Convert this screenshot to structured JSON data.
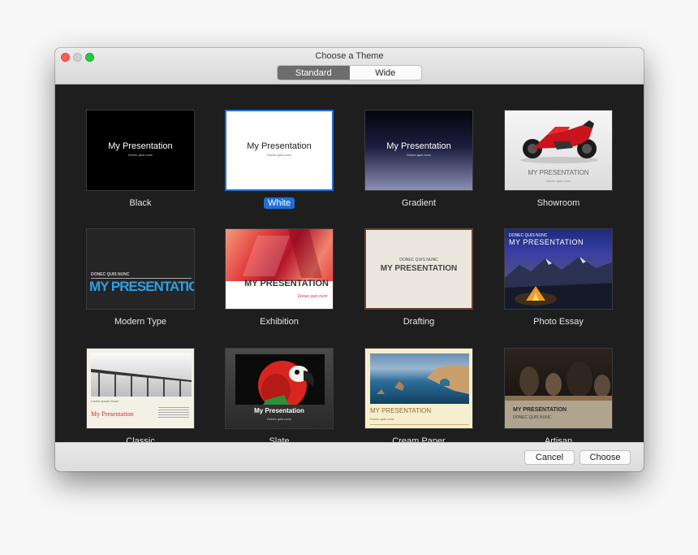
{
  "window": {
    "title": "Choose a Theme"
  },
  "segmented": {
    "standard": "Standard",
    "wide": "Wide"
  },
  "themes": [
    {
      "name": "Black",
      "title": "My Presentation",
      "subtitle": "Donec quis nunc"
    },
    {
      "name": "White",
      "title": "My Presentation",
      "subtitle": "Donec quis nunc"
    },
    {
      "name": "Gradient",
      "title": "My Presentation",
      "subtitle": "Donec quis nunc"
    },
    {
      "name": "Showroom",
      "title": "MY PRESENTATION",
      "subtitle": "Donec quis nunc"
    },
    {
      "name": "Modern Type",
      "title": "MY PRESENTATION",
      "subtitle": "DONEC QUIS NUNC"
    },
    {
      "name": "Exhibition",
      "title": "MY PRESENTATION",
      "subtitle": "Donec quis nunc"
    },
    {
      "name": "Drafting",
      "title": "MY PRESENTATION",
      "subtitle": "DONEC QUIS NUNC"
    },
    {
      "name": "Photo Essay",
      "title": "MY PRESENTATION",
      "subtitle": "DONEC QUIS NUNC"
    },
    {
      "name": "Classic",
      "title": "My Presentation",
      "subtitle": "Lorem Ipsum Dolor"
    },
    {
      "name": "Slate",
      "title": "My Presentation",
      "subtitle": "Donec quis nunc"
    },
    {
      "name": "Cream Paper",
      "title": "MY PRESENTATION",
      "subtitle": "Donec quis nunc"
    },
    {
      "name": "Artisan",
      "title": "MY PRESENTATION",
      "subtitle": "DONEC QUIS NUNC"
    }
  ],
  "buttons": {
    "cancel": "Cancel",
    "choose": "Choose"
  },
  "colors": {
    "selection": "#1e6fd9",
    "close": "#fc5d57",
    "maximize": "#2ac841"
  }
}
